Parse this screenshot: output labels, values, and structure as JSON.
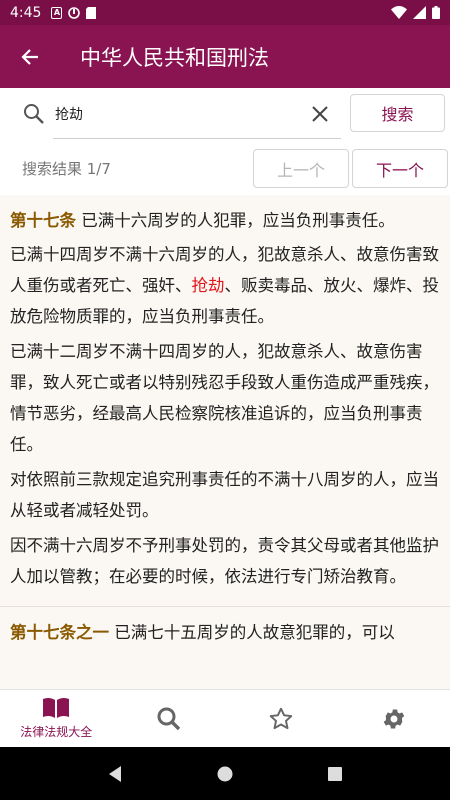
{
  "status": {
    "time": "4:45"
  },
  "appbar": {
    "title": "中华人民共和国刑法"
  },
  "search": {
    "query": "抢劫",
    "search_button": "搜索",
    "result_count": "搜索结果 1/7",
    "prev_button": "上一个",
    "next_button": "下一个"
  },
  "article1": {
    "number": "第十七条",
    "first_line": "已满十六周岁的人犯罪，应当负刑事责任。",
    "p1_before": "已满十四周岁不满十六周岁的人，犯故意杀人、故意伤害致人重伤或者死亡、强奸、",
    "p1_highlight": "抢劫",
    "p1_after": "、贩卖毒品、放火、爆炸、投放危险物质罪的，应当负刑事责任。",
    "p2": "已满十二周岁不满十四周岁的人，犯故意杀人、故意伤害罪，致人死亡或者以特别残忍手段致人重伤造成严重残疾，情节恶劣，经最高人民检察院核准追诉的，应当负刑事责任。",
    "p3": "对依照前三款规定追究刑事责任的不满十八周岁的人，应当从轻或者减轻处罚。",
    "p4": "因不满十六周岁不予刑事处罚的，责令其父母或者其他监护人加以管教；在必要的时候，依法进行专门矫治教育。"
  },
  "article2": {
    "number": "第十七条之一",
    "first_line": "已满七十五周岁的人故意犯罪的，可以"
  },
  "bottom_nav": {
    "library_label": "法律法规大全"
  },
  "colors": {
    "primary": "#8a1352",
    "status_bar": "#7a0f47",
    "highlight": "#e0151b",
    "article_number": "#8a5a00"
  }
}
